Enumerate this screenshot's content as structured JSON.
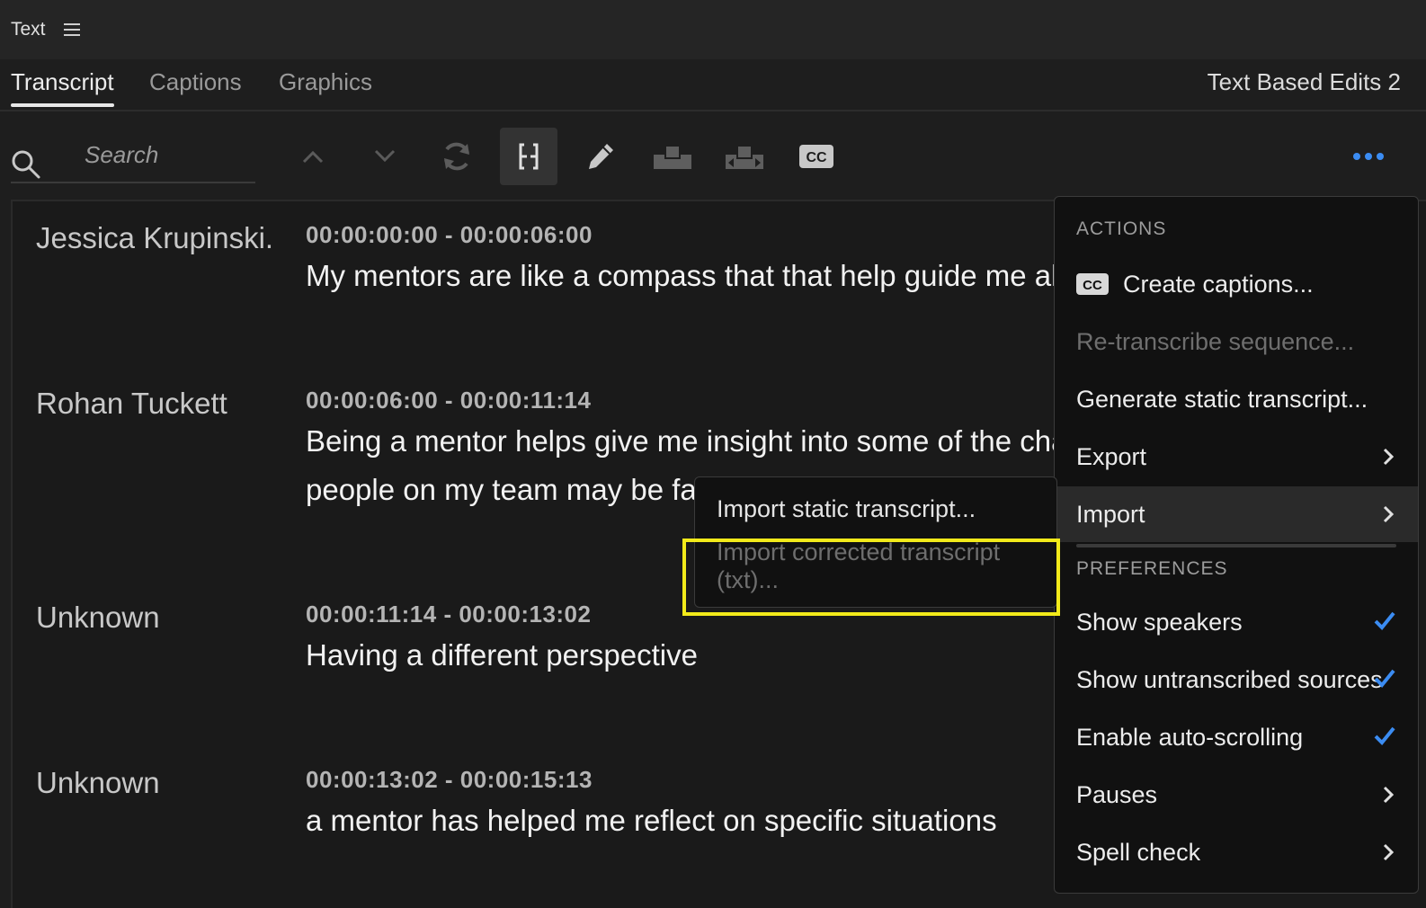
{
  "panel": {
    "title": "Text"
  },
  "tabs": [
    {
      "label": "Transcript"
    },
    {
      "label": "Captions"
    },
    {
      "label": "Graphics"
    }
  ],
  "sequence_name": "Text Based Edits 2",
  "search": {
    "placeholder": "Search"
  },
  "toolbar": {
    "icons": [
      "search-icon",
      "chevron-up-icon",
      "chevron-down-icon",
      "refresh-icon",
      "split-clip-icon",
      "pencil-icon",
      "insert-icon",
      "overwrite-icon",
      "cc-icon",
      "more-icon"
    ]
  },
  "transcript": [
    {
      "speaker": "Jessica Krupinski.",
      "timecode": "00:00:00:00 - 00:00:06:00",
      "lines": [
        "My mentors are like a compass that that help guide me alor"
      ]
    },
    {
      "speaker": "Rohan Tuckett",
      "timecode": "00:00:06:00 - 00:00:11:14",
      "lines": [
        "Being a mentor helps give me insight into some of the chall",
        "people on my team may be fac"
      ]
    },
    {
      "speaker": "Unknown",
      "timecode": "00:00:11:14 - 00:00:13:02",
      "lines": [
        "Having a different perspective"
      ]
    },
    {
      "speaker": "Unknown",
      "timecode": "00:00:13:02 - 00:00:15:13",
      "lines": [
        "a mentor has helped me reflect on specific situations"
      ]
    }
  ],
  "menu": {
    "actions_heading": "ACTIONS",
    "items": [
      {
        "label": "Create captions...",
        "enabled": true
      },
      {
        "label": "Re-transcribe sequence...",
        "enabled": false
      },
      {
        "label": "Generate static transcript...",
        "enabled": true
      },
      {
        "label": "Export",
        "enabled": true,
        "submenu": true
      },
      {
        "label": "Import",
        "enabled": true,
        "submenu": true,
        "hovered": true
      }
    ],
    "preferences_heading": "PREFERENCES",
    "preferences": [
      {
        "label": "Show speakers",
        "checked": true
      },
      {
        "label": "Show untranscribed sources",
        "checked": true
      },
      {
        "label": "Enable auto-scrolling",
        "checked": true
      },
      {
        "label": "Pauses",
        "submenu": true
      },
      {
        "label": "Spell check",
        "submenu": true
      }
    ]
  },
  "import_submenu": [
    {
      "label": "Import static transcript...",
      "enabled": true
    },
    {
      "label": "Import corrected transcript (txt)...",
      "enabled": false
    }
  ],
  "colors": {
    "accent": "#3b8cf2",
    "highlight": "#f2ea1a",
    "background": "#1e1e1e"
  }
}
